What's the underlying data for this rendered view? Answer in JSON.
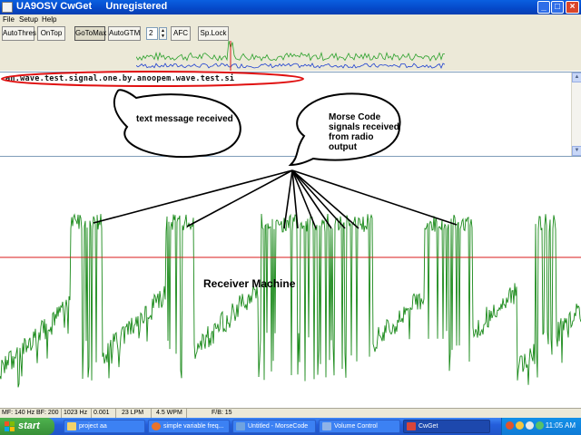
{
  "window": {
    "title": "UA9OSV CwGet     Unregistered",
    "icons": {
      "app": "cwget-app-icon",
      "minimize": "minimize-icon",
      "maximize": "maximize-icon",
      "close": "close-icon"
    }
  },
  "menu": [
    "File",
    "Setup",
    "Help"
  ],
  "toolbar": {
    "buttons": [
      "AutoThres",
      "OnTop",
      "GoToMax",
      "AutoGTM"
    ],
    "averaging_value": "2",
    "afc_label": "AFC",
    "splock_label": "Sp.Lock"
  },
  "decoded_text": "an.wave.test.signal.one.by.anoopem.wave.test.si",
  "annotations": {
    "text_received": "text message received",
    "morse_signals": "Morse Code signals received from radio output",
    "receiver_machine": "Receiver Machine"
  },
  "status": [
    "MF: 140 Hz",
    "BF: 200",
    "1023 Hz",
    "0.001",
    "23 LPM",
    "4.5 WPM",
    "F/B: 15"
  ],
  "taskbar": {
    "start": "start",
    "tasks": [
      "project aa",
      "simple variable freq...",
      "Untitled - MorseCode",
      "Volume Control",
      "CwGet"
    ],
    "active_task": "CwGet",
    "clock": "11:05 AM"
  },
  "colors": {
    "waveform": "#1a8a1a",
    "threshold": "#d81b1b",
    "spectrum_green": "#2aa02a",
    "spectrum_blue": "#1c3fd0",
    "annotation_circle": "#e01010",
    "titlebar": "#0a5fe0"
  }
}
